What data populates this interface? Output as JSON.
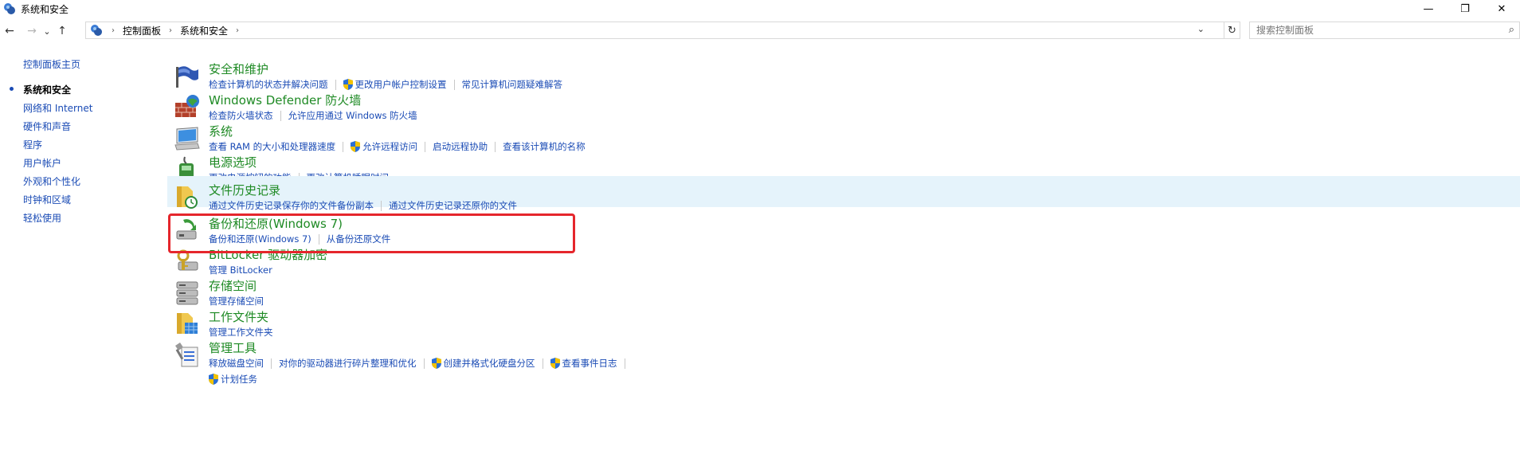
{
  "window": {
    "title": "系统和安全",
    "minimize": "—",
    "restore": "❐",
    "close": "✕"
  },
  "nav": {
    "back": "←",
    "forward": "→",
    "recent": "⌄",
    "up": "↑"
  },
  "address": {
    "crumbs": [
      "控制面板",
      "系统和安全"
    ],
    "sep": "›",
    "dropdown": "⌄",
    "refresh": "↻"
  },
  "search": {
    "placeholder": "搜索控制面板",
    "icon": "⌕"
  },
  "sidebar": {
    "home": "控制面板主页",
    "items": [
      {
        "label": "系统和安全",
        "current": true
      },
      {
        "label": "网络和 Internet"
      },
      {
        "label": "硬件和声音"
      },
      {
        "label": "程序"
      },
      {
        "label": "用户帐户"
      },
      {
        "label": "外观和个性化"
      },
      {
        "label": "时钟和区域"
      },
      {
        "label": "轻松使用"
      }
    ]
  },
  "categories": [
    {
      "title": "安全和维护",
      "icon": "flag-icon",
      "links": [
        "检查计算机的状态并解决问题",
        "更改用户帐户控制设置",
        "常见计算机问题疑难解答"
      ]
    },
    {
      "title": "Windows Defender 防火墙",
      "icon": "firewall-icon",
      "links": [
        "检查防火墙状态",
        "允许应用通过 Windows 防火墙"
      ]
    },
    {
      "title": "系统",
      "icon": "computer-icon",
      "links": [
        "查看 RAM 的大小和处理器速度",
        "允许远程访问",
        "启动远程协助",
        "查看该计算机的名称"
      ]
    },
    {
      "title": "电源选项",
      "icon": "power-icon",
      "links": [
        "更改电源按钮的功能",
        "更改计算机睡眠时间"
      ]
    },
    {
      "title": "文件历史记录",
      "icon": "file-history-icon",
      "links": [
        "通过文件历史记录保存你的文件备份副本",
        "通过文件历史记录还原你的文件"
      ]
    },
    {
      "title": "备份和还原(Windows 7)",
      "icon": "backup-icon",
      "links": [
        "备份和还原(Windows 7)",
        "从备份还原文件"
      ]
    },
    {
      "title": "BitLocker 驱动器加密",
      "icon": "bitlocker-icon",
      "links": [
        "管理 BitLocker"
      ]
    },
    {
      "title": "存储空间",
      "icon": "storage-icon",
      "links": [
        "管理存储空间"
      ]
    },
    {
      "title": "工作文件夹",
      "icon": "work-folders-icon",
      "links": [
        "管理工作文件夹"
      ]
    },
    {
      "title": "管理工具",
      "icon": "admin-tools-icon",
      "links": [
        "释放磁盘空间",
        "对你的驱动器进行碎片整理和优化",
        "创建并格式化硬盘分区",
        "查看事件日志",
        "计划任务"
      ]
    }
  ]
}
